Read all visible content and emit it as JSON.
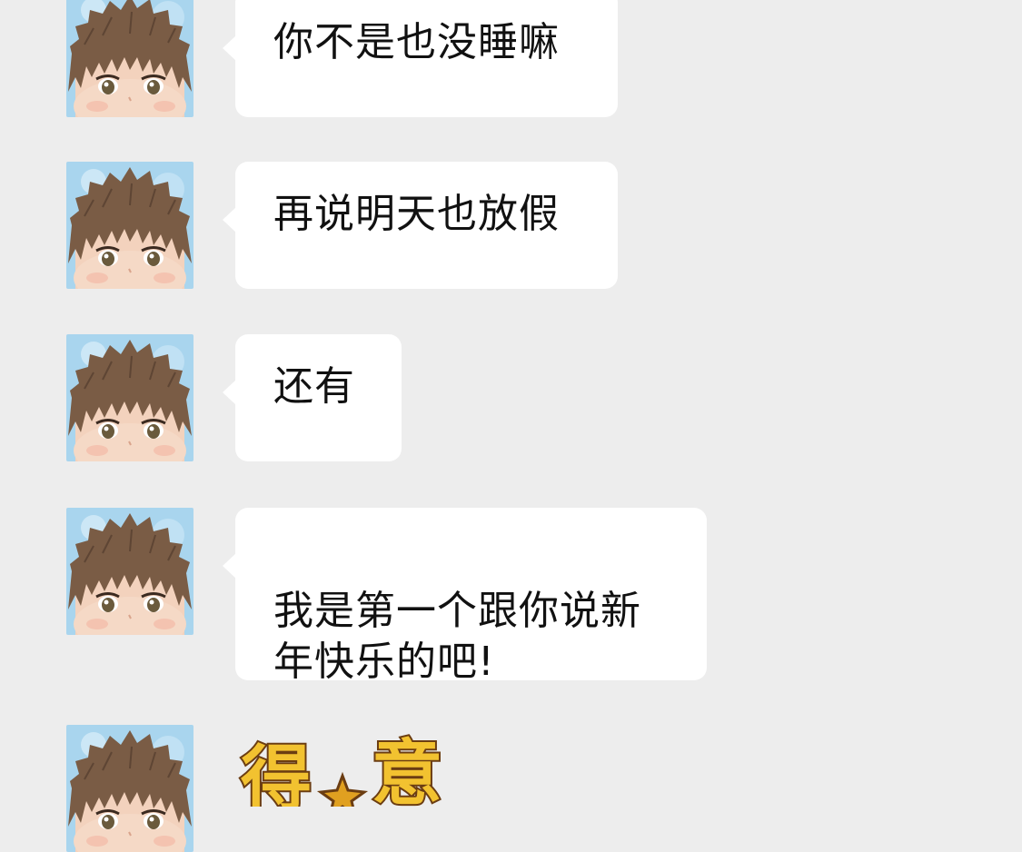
{
  "messages": [
    {
      "text": "你不是也没睡嘛"
    },
    {
      "text": "再说明天也放假"
    },
    {
      "text": "还有"
    },
    {
      "text": "我是第一个跟你说新\n年快乐的吧!"
    }
  ],
  "sticker": {
    "text": "得意"
  },
  "colors": {
    "background": "#ededed",
    "bubble": "#ffffff",
    "text": "#111111",
    "sticker_fill": "#f2c230",
    "sticker_outline": "#6b3d12"
  },
  "icons": [
    "avatar-boy-icon",
    "star-icon"
  ]
}
